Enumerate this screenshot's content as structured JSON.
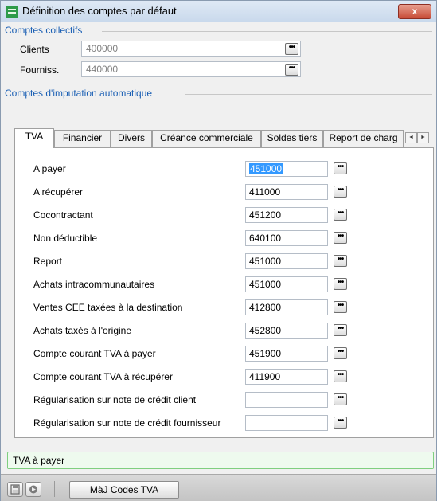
{
  "window": {
    "title": "Définition des comptes par défaut",
    "close_label": "x"
  },
  "collective": {
    "heading": "Comptes collectifs",
    "clients_label": "Clients",
    "clients_value": "400000",
    "suppliers_label": "Fourniss.",
    "suppliers_value": "440000"
  },
  "auto": {
    "heading": "Comptes d'imputation automatique"
  },
  "tabs": [
    {
      "label": "TVA"
    },
    {
      "label": "Financier"
    },
    {
      "label": "Divers"
    },
    {
      "label": "Créance commerciale"
    },
    {
      "label": "Soldes tiers"
    },
    {
      "label": "Report de charg"
    }
  ],
  "tab_scroll": {
    "left": "◄",
    "right": "►"
  },
  "rows": [
    {
      "label": "A payer",
      "value": "451000"
    },
    {
      "label": "A récupérer",
      "value": "411000"
    },
    {
      "label": "Cocontractant",
      "value": "451200"
    },
    {
      "label": "Non déductible",
      "value": "640100"
    },
    {
      "label": "Report",
      "value": "451000"
    },
    {
      "label": "Achats intracommunautaires",
      "value": "451000"
    },
    {
      "label": "Ventes CEE taxées à la destination",
      "value": "412800"
    },
    {
      "label": "Achats taxés à l'origine",
      "value": "452800"
    },
    {
      "label": "Compte courant TVA à payer",
      "value": "451900"
    },
    {
      "label": "Compte courant TVA à récupérer",
      "value": "411900"
    },
    {
      "label": "Régularisation sur note de crédit client",
      "value": ""
    },
    {
      "label": "Régularisation sur note de crédit fournisseur",
      "value": ""
    }
  ],
  "dots_label": "•••",
  "status_text": "TVA à payer",
  "bottom": {
    "tva_button": "MàJ Codes TVA"
  }
}
